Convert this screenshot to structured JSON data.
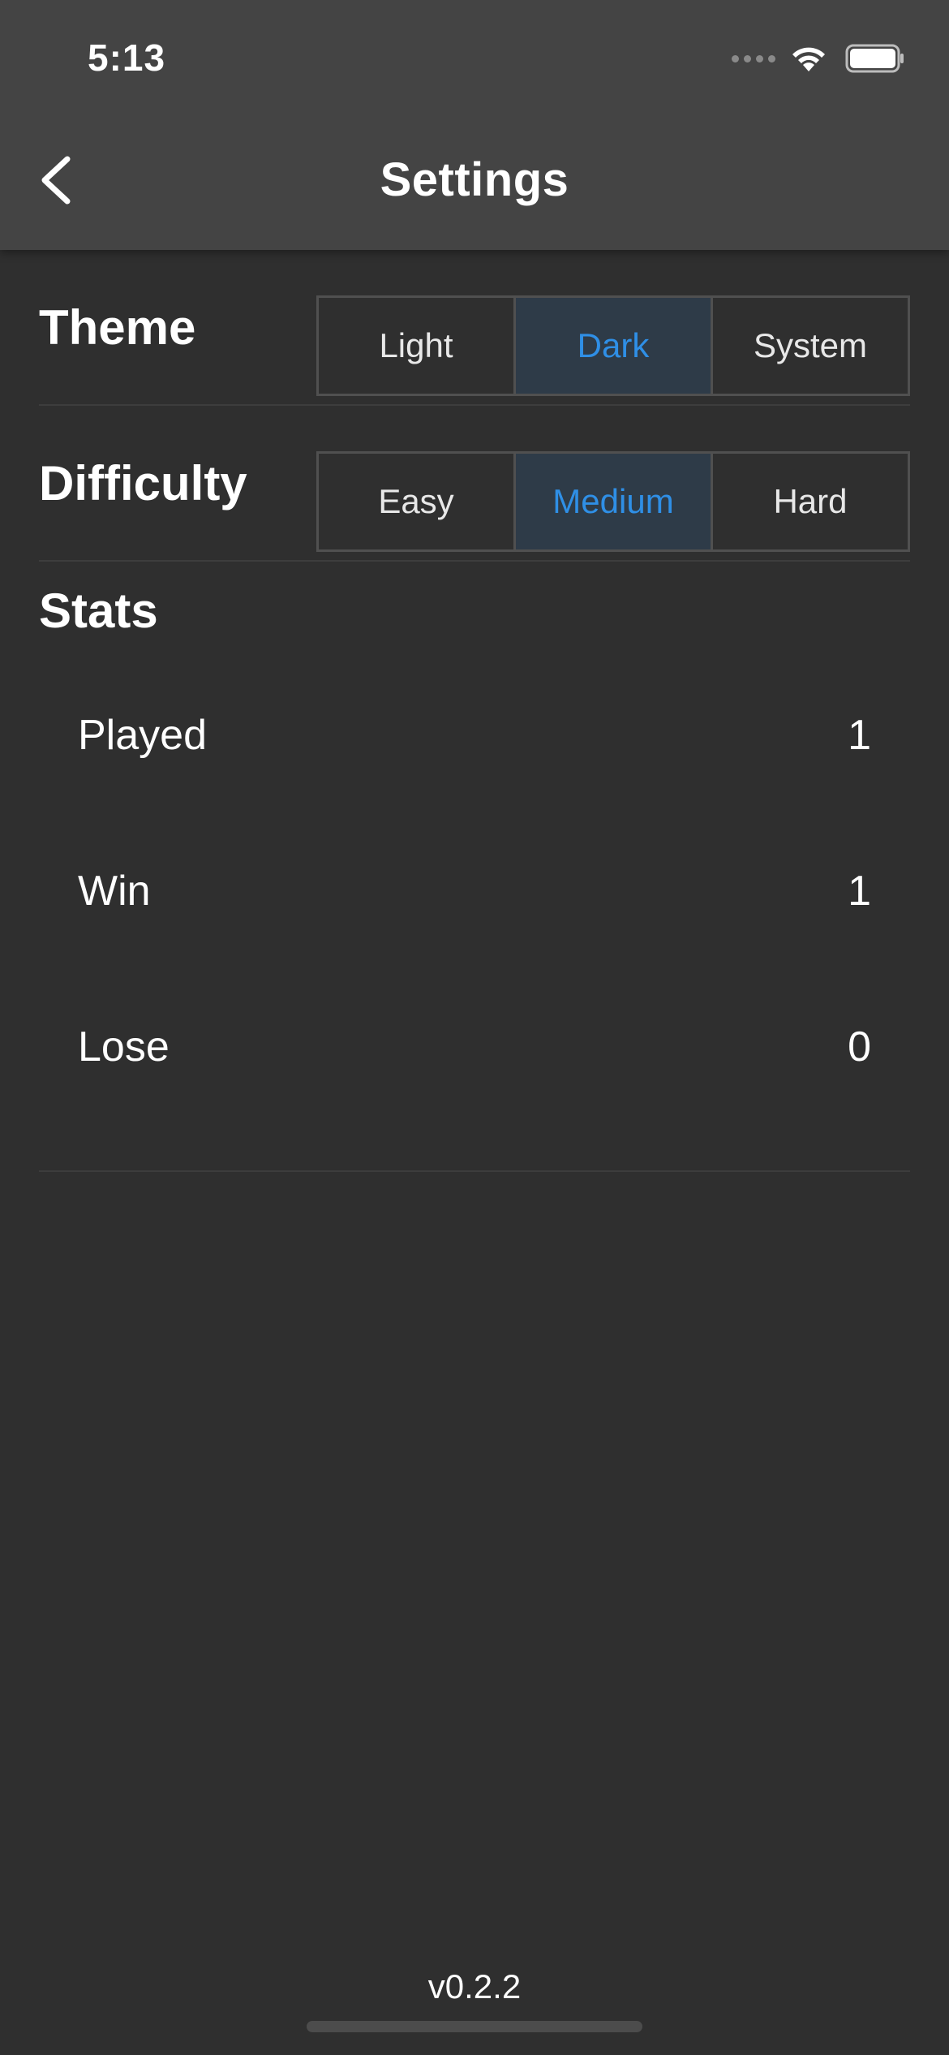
{
  "status_bar": {
    "time": "5:13"
  },
  "nav": {
    "title": "Settings",
    "back_icon": "chevron-left-icon"
  },
  "theme": {
    "label": "Theme",
    "options": [
      "Light",
      "Dark",
      "System"
    ],
    "selected": "Dark"
  },
  "difficulty": {
    "label": "Difficulty",
    "options": [
      "Easy",
      "Medium",
      "Hard"
    ],
    "selected": "Medium"
  },
  "stats": {
    "title": "Stats",
    "rows": [
      {
        "label": "Played",
        "value": "1"
      },
      {
        "label": "Win",
        "value": "1"
      },
      {
        "label": "Lose",
        "value": "0"
      }
    ]
  },
  "footer": {
    "version": "v0.2.2"
  },
  "colors": {
    "accent": "#2f8fe6",
    "background": "#2f2f2f",
    "header": "#444444"
  }
}
